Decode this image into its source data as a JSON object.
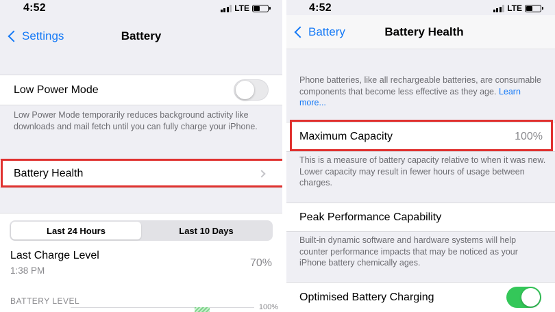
{
  "left": {
    "status": {
      "time": "4:52",
      "network": "LTE"
    },
    "nav": {
      "back_label": "Settings",
      "title": "Battery"
    },
    "low_power": {
      "label": "Low Power Mode",
      "enabled": false,
      "footer": "Low Power Mode temporarily reduces background activity like downloads and mail fetch until you can fully charge your iPhone."
    },
    "battery_health": {
      "label": "Battery Health"
    },
    "segments": [
      {
        "label": "Last 24 Hours",
        "selected": true
      },
      {
        "label": "Last 10 Days",
        "selected": false
      }
    ],
    "last_charge": {
      "label": "Last Charge Level",
      "time": "1:38 PM",
      "value": "70%"
    },
    "battery_level": {
      "caption": "BATTERY LEVEL",
      "axis_max": "100%"
    }
  },
  "right": {
    "status": {
      "time": "4:52",
      "network": "LTE"
    },
    "nav": {
      "back_label": "Battery",
      "title": "Battery Health"
    },
    "intro": {
      "text": "Phone batteries, like all rechargeable batteries, are consumable components that become less effective as they age.",
      "link": "Learn more..."
    },
    "max_capacity": {
      "label": "Maximum Capacity",
      "value": "100%",
      "footer": "This is a measure of battery capacity relative to when it was new. Lower capacity may result in fewer hours of usage between charges."
    },
    "peak_performance": {
      "label": "Peak Performance Capability",
      "footer": "Built-in dynamic software and hardware systems will help counter performance impacts that may be noticed as your iPhone battery chemically ages."
    },
    "optimised_charging": {
      "label": "Optimised Battery Charging",
      "enabled": true
    }
  },
  "colors": {
    "accent": "#1479f6",
    "toggle_on": "#34c759",
    "highlight": "#e0312f",
    "grouped_background": "#efeff4",
    "secondary_text": "#6d6d72"
  },
  "icons": {
    "back": "chevron-left-icon",
    "disclosure": "chevron-right-icon",
    "signal": "cellular-signal-icon",
    "battery": "battery-icon"
  }
}
